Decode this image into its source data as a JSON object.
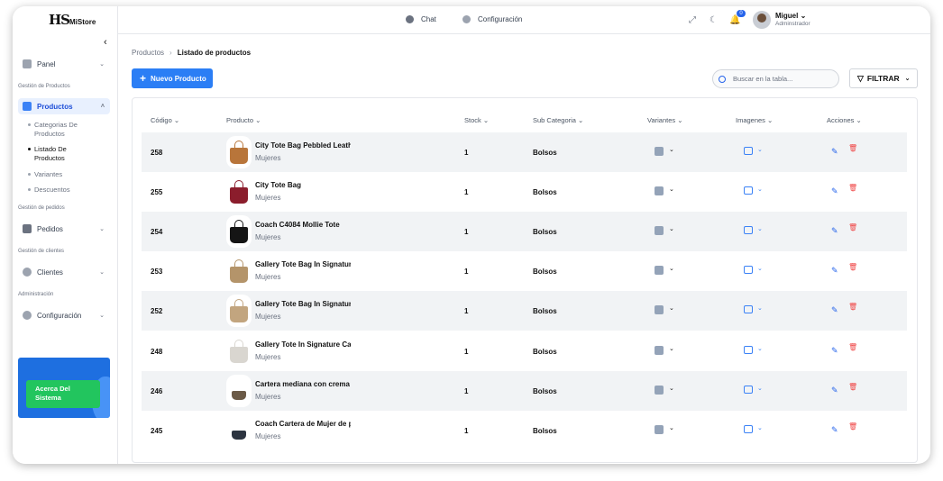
{
  "logo": {
    "text": "HS",
    "sub": "MiStore"
  },
  "sidebar": {
    "items": [
      {
        "label": "Panel"
      },
      {
        "label": "Productos"
      },
      {
        "label": "Pedidos"
      },
      {
        "label": "Clientes"
      },
      {
        "label": "Configuración"
      }
    ],
    "sections": [
      "Gestión de Productos",
      "Gestión de pedidos",
      "Gestión de clientes",
      "Administración"
    ],
    "subitems": [
      "Categorias De Productos",
      "Listado De Productos",
      "Variantes",
      "Descuentos"
    ],
    "about_label": "Acerca Del Sistema"
  },
  "topbar": {
    "chat_label": "Chat",
    "config_label": "Configuración",
    "notification_count": "0",
    "user_name": "Miguel",
    "user_role": "Adminstrador"
  },
  "breadcrumb": {
    "parent": "Productos",
    "current": "Listado de productos"
  },
  "toolbar": {
    "new_label": "Nuevo Producto",
    "search_placeholder": "Buscar en la tabla...",
    "filter_label": "FILTRAR"
  },
  "table": {
    "columns": [
      "Código",
      "Producto",
      "Stock",
      "Sub Categoria",
      "Variantes",
      "Imagenes",
      "Acciones"
    ],
    "rows": [
      {
        "code": "258",
        "name": "City Tote Bag Pebbled Leather",
        "category": "Mujeres",
        "stock": "1",
        "subcategory": "Bolsos",
        "bag_color": "#b8753a"
      },
      {
        "code": "255",
        "name": "City Tote Bag",
        "category": "Mujeres",
        "stock": "1",
        "subcategory": "Bolsos",
        "bag_color": "#8b1d2c"
      },
      {
        "code": "254",
        "name": "Coach C4084 Mollie Tote",
        "category": "Mujeres",
        "stock": "1",
        "subcategory": "Bolsos",
        "bag_color": "#151515"
      },
      {
        "code": "253",
        "name": "Gallery Tote Bag In Signature",
        "category": "Mujeres",
        "stock": "1",
        "subcategory": "Bolsos",
        "bag_color": "#b4946a"
      },
      {
        "code": "252",
        "name": "Gallery Tote Bag In Signature",
        "category": "Mujeres",
        "stock": "1",
        "subcategory": "Bolsos",
        "bag_color": "#c2a57f"
      },
      {
        "code": "248",
        "name": "Gallery Tote In Signature Canvas",
        "category": "Mujeres",
        "stock": "1",
        "subcategory": "Bolsos",
        "bag_color": "#d9d6d0"
      },
      {
        "code": "246",
        "name": "Cartera mediana con crema",
        "category": "Mujeres",
        "stock": "1",
        "subcategory": "Bolsos",
        "bag_color": "#6b5a47"
      },
      {
        "code": "245",
        "name": "Coach Cartera de Mujer de piel",
        "category": "Mujeres",
        "stock": "1",
        "subcategory": "Bolsos",
        "bag_color": "#2c3440"
      }
    ]
  },
  "colors": {
    "accent": "#2b7ef5",
    "success": "#22c55e",
    "danger": "#ef4444"
  }
}
